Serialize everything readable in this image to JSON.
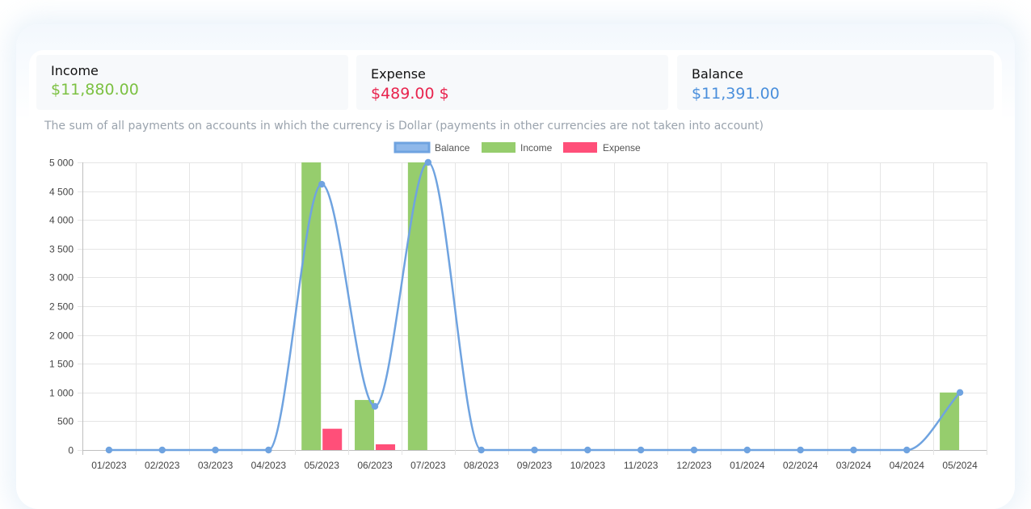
{
  "stats": {
    "income": {
      "label": "Income",
      "value": "$11,880.00",
      "color": "#7cc142"
    },
    "expense": {
      "label": "Expense",
      "value": "$489.00 $",
      "color": "#e8244e"
    },
    "balance": {
      "label": "Balance",
      "value": "$11,391.00",
      "color": "#4a8fdc"
    }
  },
  "note": "The sum of all payments on accounts in which the currency is Dollar (payments in other currencies are not taken into account)",
  "chart_data": {
    "type": "bar",
    "categories": [
      "01/2023",
      "02/2023",
      "03/2023",
      "04/2023",
      "05/2023",
      "06/2023",
      "07/2023",
      "08/2023",
      "09/2023",
      "10/2023",
      "11/2023",
      "12/2023",
      "01/2024",
      "02/2024",
      "03/2024",
      "04/2024",
      "05/2024"
    ],
    "y_ticks": [
      "0",
      "500",
      "1 000",
      "1 500",
      "2 000",
      "2 500",
      "3 000",
      "3 500",
      "4 000",
      "4 500",
      "5 000"
    ],
    "ylim": [
      0,
      5000
    ],
    "grid": true,
    "legend_position": "top-center",
    "series": [
      {
        "name": "Balance",
        "type": "line",
        "color": "#6fa3e0",
        "values": [
          0,
          0,
          0,
          0,
          4620,
          760,
          5000,
          0,
          0,
          0,
          0,
          0,
          0,
          0,
          0,
          0,
          1000
        ]
      },
      {
        "name": "Income",
        "type": "bar",
        "color": "#96cd6d",
        "values": [
          0,
          0,
          0,
          0,
          5000,
          870,
          5000,
          0,
          0,
          0,
          0,
          0,
          0,
          0,
          0,
          0,
          1000
        ]
      },
      {
        "name": "Expense",
        "type": "bar",
        "color": "#ff4f79",
        "values": [
          0,
          0,
          0,
          0,
          370,
          100,
          0,
          0,
          0,
          0,
          0,
          0,
          0,
          0,
          0,
          0,
          0
        ]
      }
    ]
  }
}
